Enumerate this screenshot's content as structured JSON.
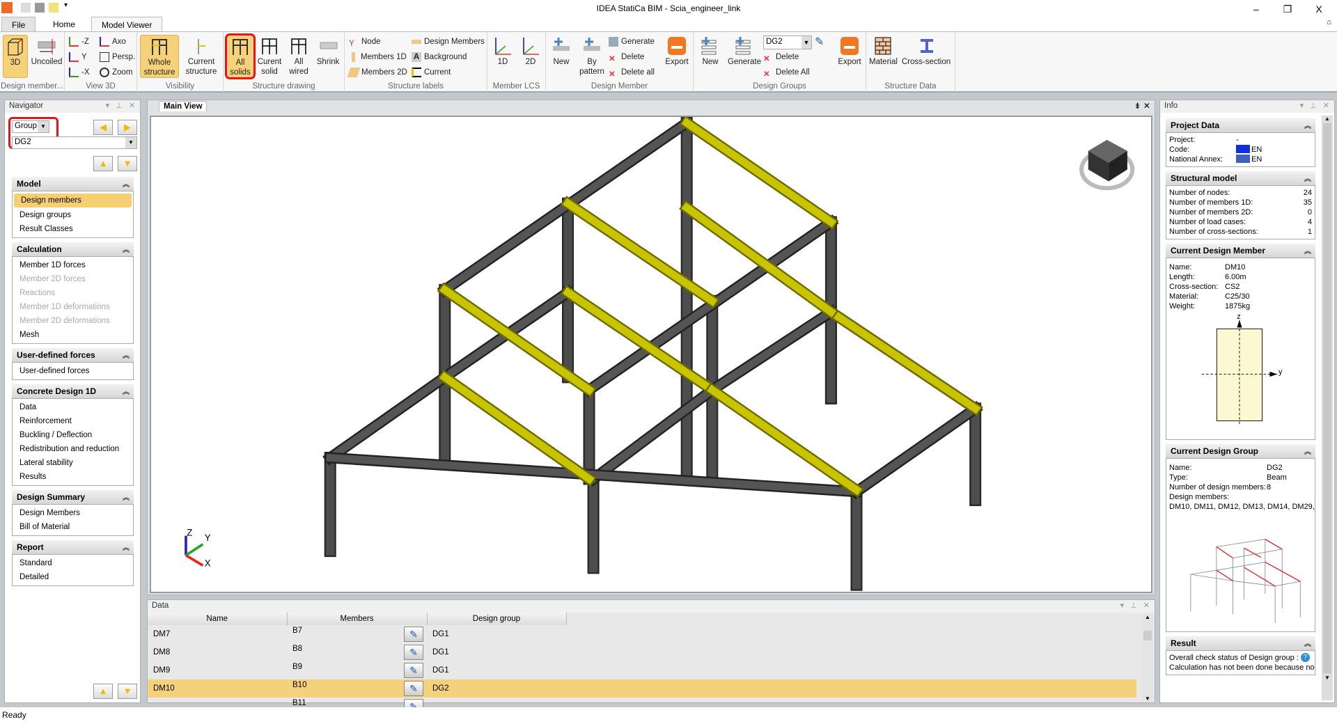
{
  "window": {
    "title": "IDEA StatiCa BIM - Scia_engineer_link",
    "minimize": "–",
    "restore": "❐",
    "close": "X"
  },
  "tabs": [
    {
      "label": "File"
    },
    {
      "label": "Home"
    },
    {
      "label": "Model Viewer"
    }
  ],
  "ribbon": {
    "groups": [
      {
        "label": "Design member...",
        "buttons": [
          "3D",
          "Uncoiled"
        ]
      },
      {
        "label": "View 3D",
        "buttons": [
          "-Z",
          "Y",
          "-X",
          "Axo",
          "Persp.",
          "Zoom"
        ]
      },
      {
        "label": "Visibility",
        "buttons": [
          "Whole structure",
          "Current structure"
        ]
      },
      {
        "label": "Structure drawing",
        "buttons": [
          "All solids",
          "Curent solid",
          "All wired",
          "Shrink"
        ]
      },
      {
        "label": "Structure labels",
        "buttons": [
          "Node",
          "Members 1D",
          "Members 2D",
          "Design Members",
          "Background",
          "Current"
        ]
      },
      {
        "label": "Member LCS",
        "buttons": [
          "1D",
          "2D"
        ]
      },
      {
        "label": "Design Member",
        "buttons": [
          "New",
          "By pattern",
          "Generate",
          "Delete",
          "Delete all",
          "Export"
        ]
      },
      {
        "label": "Design Groups",
        "buttons": [
          "New",
          "Generate",
          "Delete",
          "Delete All",
          "Export"
        ],
        "select": "DG2"
      },
      {
        "label": "Structure Data",
        "buttons": [
          "Material",
          "Cross-section"
        ]
      }
    ],
    "split_labels": {
      "whole1": "Whole",
      "whole2": "structure",
      "cur1": "Current",
      "cur2": "structure",
      "alls1": "All",
      "alls2": "solids",
      "curs1": "Curent",
      "curs2": "solid",
      "allw1": "All",
      "allw2": "wired",
      "bp1": "By",
      "bp2": "pattern"
    }
  },
  "navigator": {
    "title": "Navigator",
    "type_select": "Group",
    "group_select": "DG2",
    "sections": [
      {
        "title": "Model",
        "items": [
          {
            "label": "Design members",
            "selected": true
          },
          {
            "label": "Design groups"
          },
          {
            "label": "Result Classes"
          }
        ]
      },
      {
        "title": "Calculation",
        "items": [
          {
            "label": "Member 1D forces"
          },
          {
            "label": "Member 2D forces",
            "disabled": true
          },
          {
            "label": "Reactions",
            "disabled": true
          },
          {
            "label": "Member 1D deformations",
            "disabled": true
          },
          {
            "label": "Member 2D deformations",
            "disabled": true
          },
          {
            "label": "Mesh"
          }
        ]
      },
      {
        "title": "User-defined forces",
        "items": [
          {
            "label": "User-defined forces"
          }
        ]
      },
      {
        "title": "Concrete Design 1D",
        "items": [
          {
            "label": "Data"
          },
          {
            "label": "Reinforcement"
          },
          {
            "label": "Buckling / Deflection"
          },
          {
            "label": "Redistribution and reduction"
          },
          {
            "label": "Lateral stability"
          },
          {
            "label": "Results"
          }
        ]
      },
      {
        "title": "Design Summary",
        "items": [
          {
            "label": "Design Members"
          },
          {
            "label": "Bill of Material"
          }
        ]
      },
      {
        "title": "Report",
        "items": [
          {
            "label": "Standard"
          },
          {
            "label": "Detailed"
          }
        ]
      }
    ]
  },
  "main_view": {
    "tab": "Main View",
    "axes": {
      "x": "X",
      "y": "Y",
      "z": "Z"
    }
  },
  "data_panel": {
    "title": "Data",
    "columns": [
      "Name",
      "Members",
      "Design group"
    ],
    "rows": [
      {
        "name": "DM7",
        "members": "B7",
        "group": "DG1"
      },
      {
        "name": "DM8",
        "members": "B8",
        "group": "DG1"
      },
      {
        "name": "DM9",
        "members": "B9",
        "group": "DG1"
      },
      {
        "name": "DM10",
        "members": "B10",
        "group": "DG2",
        "selected": true
      },
      {
        "name": "",
        "members": "B11",
        "group": ""
      }
    ]
  },
  "info": {
    "title": "Info",
    "project_data": {
      "title": "Project Data",
      "project_label": "Project:",
      "project": "-",
      "code_label": "Code:",
      "code": "EN",
      "annex_label": "National Annex:",
      "annex": "EN"
    },
    "structural_model": {
      "title": "Structural model",
      "rows": [
        {
          "label": "Number of nodes:",
          "value": "24"
        },
        {
          "label": "Number of members 1D:",
          "value": "35"
        },
        {
          "label": "Number of members 2D:",
          "value": "0"
        },
        {
          "label": "Number of load cases:",
          "value": "4"
        },
        {
          "label": "Number of cross-sections:",
          "value": "1"
        }
      ]
    },
    "current_member": {
      "title": "Current Design Member",
      "rows": [
        {
          "label": "Name:",
          "value": "DM10"
        },
        {
          "label": "Length:",
          "value": "6.00m"
        },
        {
          "label": "Cross-section:",
          "value": "CS2"
        },
        {
          "label": "Material:",
          "value": "C25/30"
        },
        {
          "label": "Weight:",
          "value": "1875kg"
        }
      ],
      "axis_z": "z",
      "axis_y": "y"
    },
    "current_group": {
      "title": "Current Design Group",
      "name_label": "Name:",
      "name": "DG2",
      "type_label": "Type:",
      "type": "Beam",
      "count_label": "Number of design members:",
      "count": "8",
      "members_label": "Design members:",
      "members": "DM10, DM11, DM12, DM13, DM14, DM29,..."
    },
    "result": {
      "title": "Result",
      "status": "Overall check status of Design group :",
      "note": "Calculation has not been done because no"
    }
  },
  "status_bar": {
    "text": "Ready"
  },
  "colors": {
    "accent": "#f5cf72",
    "highlight": "#e8141c",
    "beam": "#c8c400",
    "column": "#4d4d4d"
  }
}
